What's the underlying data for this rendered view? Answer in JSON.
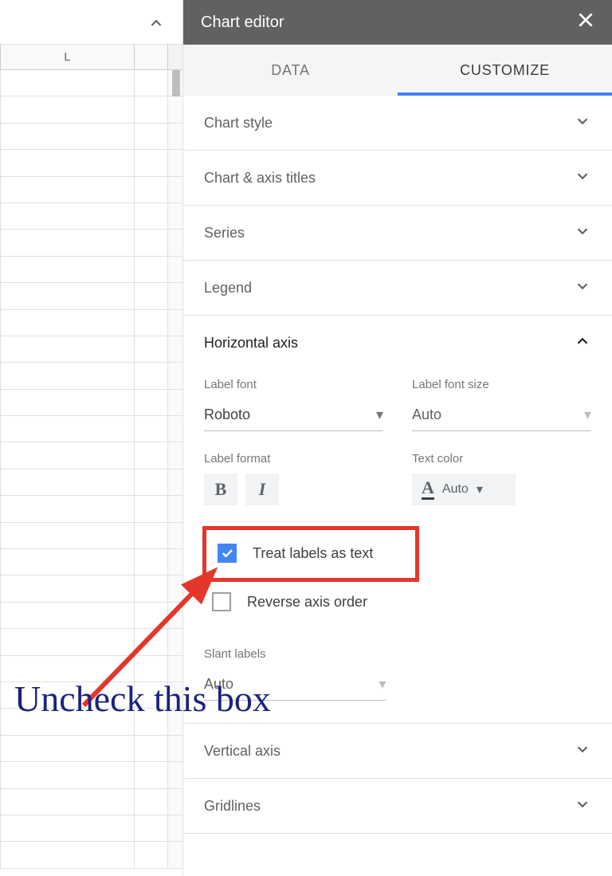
{
  "sheet": {
    "column_label": "L",
    "row_count": 30
  },
  "panel": {
    "title": "Chart editor",
    "tabs": {
      "data": "DATA",
      "customize": "CUSTOMIZE",
      "active": "customize"
    },
    "sections": {
      "chart_style": "Chart style",
      "chart_axis_titles": "Chart & axis titles",
      "series": "Series",
      "legend": "Legend",
      "horizontal_axis": "Horizontal axis",
      "vertical_axis": "Vertical axis",
      "gridlines": "Gridlines"
    },
    "horizontal_axis": {
      "label_font": {
        "label": "Label font",
        "value": "Roboto"
      },
      "label_font_size": {
        "label": "Label font size",
        "value": "Auto"
      },
      "label_format": {
        "label": "Label format"
      },
      "text_color": {
        "label": "Text color",
        "value": "Auto"
      },
      "treat_labels_as_text": {
        "label": "Treat labels as text",
        "checked": true
      },
      "reverse_axis_order": {
        "label": "Reverse axis order",
        "checked": false
      },
      "slant_labels": {
        "label": "Slant labels",
        "value": "Auto"
      }
    }
  },
  "annotation": {
    "text": "Uncheck this box"
  }
}
